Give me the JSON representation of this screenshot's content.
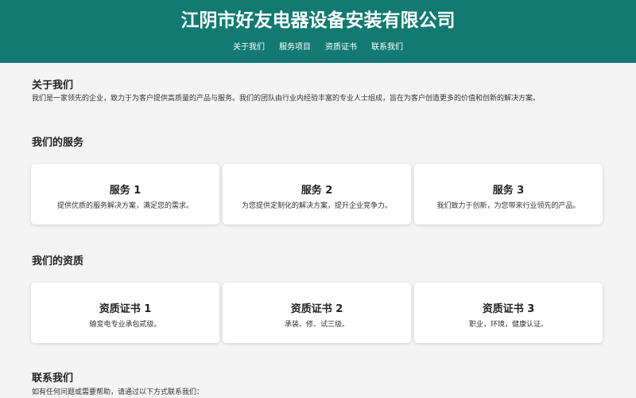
{
  "header": {
    "title": "江阴市好友电器设备安装有限公司",
    "nav": [
      "关于我们",
      "服务项目",
      "资质证书",
      "联系我们"
    ]
  },
  "about": {
    "title": "关于我们",
    "text": "我们是一家领先的企业，致力于为客户提供高质量的产品与服务。我们的团队由行业内经验丰富的专业人士组成，旨在为客户创造更多的价值和创新的解决方案。"
  },
  "services": {
    "title": "我们的服务",
    "cards": [
      {
        "title": "服务 1",
        "text": "提供优质的服务解决方案，满足您的需求。"
      },
      {
        "title": "服务 2",
        "text": "为您提供定制化的解决方案，提升企业竞争力。"
      },
      {
        "title": "服务 3",
        "text": "我们致力于创新，为您带来行业领先的产品。"
      }
    ]
  },
  "qualifications": {
    "title": "我们的资质",
    "cards": [
      {
        "title": "资质证书 1",
        "text": "输变电专业承包贰级。"
      },
      {
        "title": "资质证书 2",
        "text": "承装、修、试三级。"
      },
      {
        "title": "资质证书 3",
        "text": "职业，环境，健康认证。"
      }
    ]
  },
  "contact": {
    "title": "联系我们",
    "text": "如有任何问题或需要帮助，请通过以下方式联系我们："
  },
  "colors": {
    "header_bg": "#127a72",
    "page_bg": "#f4f4f4",
    "card_bg": "#ffffff"
  }
}
